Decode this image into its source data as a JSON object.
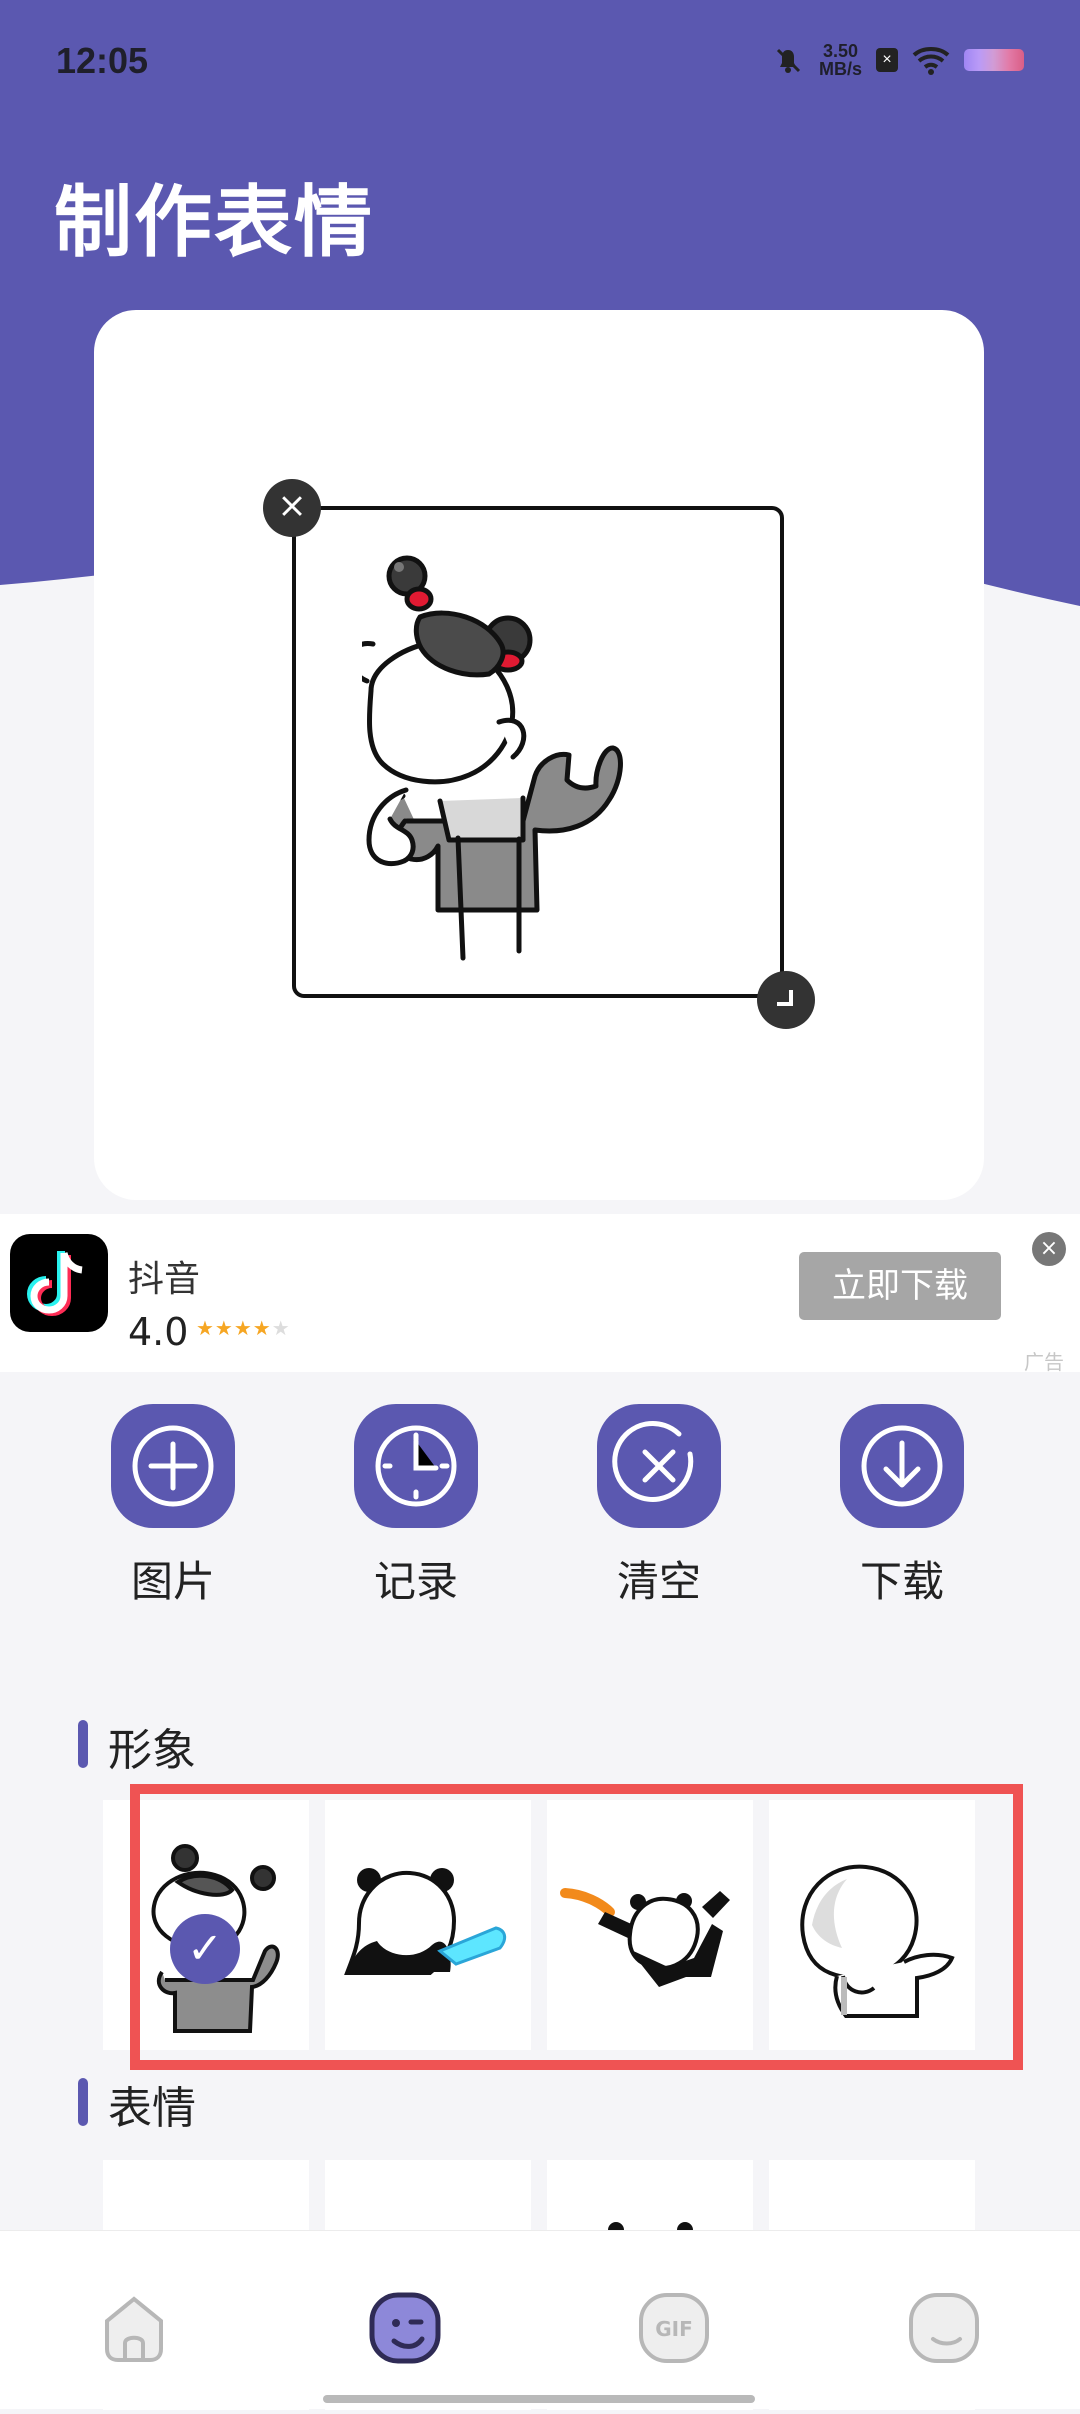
{
  "status_bar": {
    "time": "12:05",
    "network_speed_top": "3.50",
    "network_speed_bottom": "MB/s"
  },
  "header": {
    "title": "制作表情"
  },
  "ad": {
    "app_name": "抖音",
    "rating": "4.0",
    "stars": "★★★★",
    "empty_star": "★",
    "button_label": "立即下载",
    "ad_label": "广告"
  },
  "actions": [
    {
      "label": "图片",
      "icon": "plus-icon"
    },
    {
      "label": "记录",
      "icon": "clock-icon"
    },
    {
      "label": "清空",
      "icon": "clear-icon"
    },
    {
      "label": "下载",
      "icon": "download-icon"
    }
  ],
  "sections": {
    "image_title": "形象",
    "emoji_title": "表情"
  },
  "bottom_nav": {
    "items": [
      "home-icon",
      "emoji-maker-icon",
      "gif-icon",
      "sticker-icon"
    ]
  },
  "colors": {
    "primary": "#5b58b0",
    "highlight": "#ef5353",
    "background": "#f5f5f8"
  }
}
